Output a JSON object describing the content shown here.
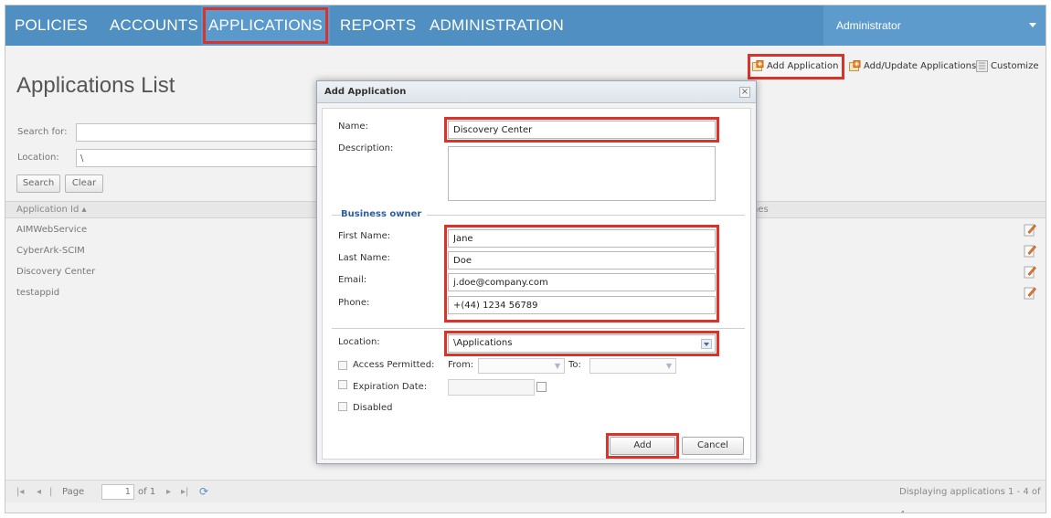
{
  "nav": {
    "items": [
      "POLICIES",
      "ACCOUNTS",
      "APPLICATIONS",
      "REPORTS",
      "ADMINISTRATION"
    ],
    "active": "APPLICATIONS",
    "user": "Administrator"
  },
  "toolbar": {
    "add_application": "Add Application",
    "add_update_applications": "Add/Update Applications",
    "customize": "Customize"
  },
  "page": {
    "title": "Applications List"
  },
  "search": {
    "search_for_label": "Search for:",
    "search_for_value": "",
    "location_label": "Location:",
    "location_value": "\\",
    "search_button": "Search",
    "clear_button": "Clear"
  },
  "grid": {
    "columns": [
      "Application Id",
      "nes"
    ],
    "rows": [
      "AIMWebService",
      "CyberArk-SCIM",
      "Discovery Center",
      "testappid"
    ]
  },
  "pager": {
    "page_label": "Page",
    "page_value": "1",
    "of_label": "of 1",
    "status": "Displaying applications 1 - 4 of 4"
  },
  "dialog": {
    "title": "Add Application",
    "close": "×",
    "name_label": "Name:",
    "name_value": "Discovery Center",
    "description_label": "Description:",
    "business_owner_label": "Business owner",
    "first_name_label": "First Name:",
    "first_name_value": "Jane",
    "last_name_label": "Last Name:",
    "last_name_value": "Doe",
    "email_label": "Email:",
    "email_value": "j.doe@company.com",
    "phone_label": "Phone:",
    "phone_value": "+(44) 1234 56789",
    "location_label": "Location:",
    "location_value": "\\Applications",
    "access_permitted_label": "Access Permitted:",
    "from_label": "From:",
    "to_label": "To:",
    "expiration_date_label": "Expiration Date:",
    "disabled_label": "Disabled",
    "add_button": "Add",
    "cancel_button": "Cancel"
  },
  "colors": {
    "nav_bg": "#4f8fc2",
    "highlight": "#d9342b",
    "section_header": "#2b5fa0"
  },
  "icons": [
    "add-application-icon",
    "add-update-applications-icon",
    "customize-icon",
    "edit-icon",
    "refresh-icon",
    "first-page-icon",
    "prev-page-icon",
    "next-page-icon",
    "last-page-icon",
    "calendar-icon",
    "close-icon",
    "chevron-down-icon"
  ]
}
